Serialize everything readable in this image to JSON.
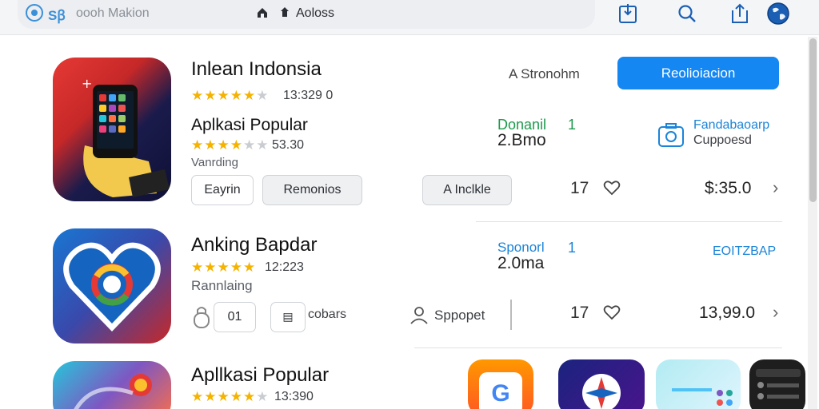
{
  "topbar": {
    "brand_code": "Sꞵ",
    "brand_text": "oooh Makion",
    "tab_text": "Aoloss"
  },
  "apps": [
    {
      "title": "Inlean Indonsia",
      "rating_text": "13:329 0",
      "stars": 4.5,
      "subtitle": "Aplkasi Popular",
      "sub_rating_text": "53.30",
      "sub_stars": 4.0,
      "category": "Vanrding",
      "btn_left": "Eayrin",
      "btn_mid": "Remonios",
      "btn_right": "A Inclkle",
      "link_text": "A Stronohm",
      "primary_label": "Reolioiacion",
      "green_label": "Donanil",
      "green_count": "1",
      "size": "2.Bmo",
      "feature_line1": "Fandabaoarp",
      "feature_line2": "Cuppoesd",
      "likes": "17",
      "price": "$:35.0"
    },
    {
      "title": "Anking Bapdar",
      "rating_text": "12:223",
      "stars": 5.0,
      "category": "Rannlaing",
      "btn_left_num": "01",
      "btn_mid": "cobars",
      "btn_right": "Sppopet",
      "blue_label": "Sponorl",
      "blue_count": "1",
      "size": "2.0ma",
      "feature_line1": "EOITZBAP",
      "likes": "17",
      "price": "13,99.0"
    },
    {
      "title": "Apllkasi Popular",
      "rating_text": "13:390",
      "stars": 4.5
    }
  ],
  "colors": {
    "accent": "#1487f3",
    "star": "#f5b301",
    "green": "#1d9a4b",
    "blue_text": "#1a84d8"
  }
}
